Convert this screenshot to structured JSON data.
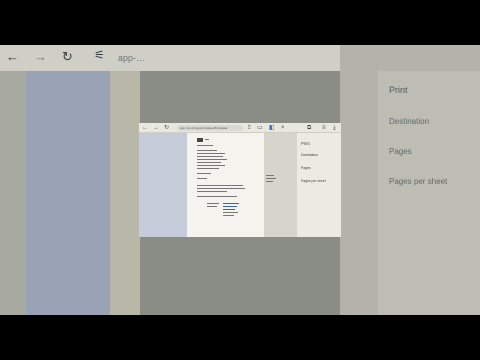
{
  "browser": {
    "address_text": "app-…",
    "inset_address_text": "app.mnr.nih.gov/bmsdeurl/formdata"
  },
  "print_panel": {
    "title": "Print",
    "destination_label": "Destination",
    "pages_label": "Pages",
    "pages_per_sheet_label": "Pages per sheet",
    "inset_title": "Print",
    "inset_destination": "Destination",
    "inset_pages": "Pages",
    "inset_pages_per_sheet": "Pages per sheet"
  },
  "icons": {
    "back": "back-arrow-icon",
    "forward": "forward-arrow-icon",
    "reload": "reload-icon",
    "site_settings": "tune-icon",
    "extensions": "puzzle-icon",
    "playlist": "playlist-add-icon",
    "download": "download-icon"
  }
}
